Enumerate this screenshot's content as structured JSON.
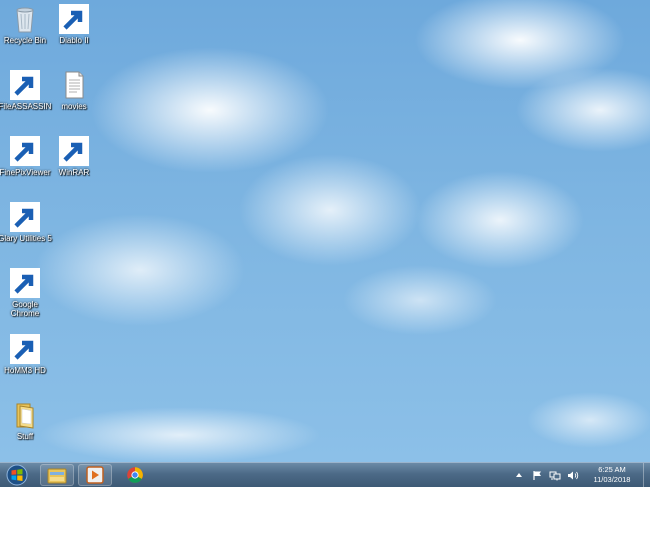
{
  "desktop": {
    "icons": [
      {
        "label": "Recycle Bin",
        "icon": "recycle-bin-icon"
      },
      {
        "label": "Diablo II",
        "icon": "diablo-icon"
      },
      {
        "label": "FileASSASSIN",
        "icon": "fileassassin-icon"
      },
      {
        "label": "movies",
        "icon": "text-file-icon"
      },
      {
        "label": "FinePixViewer",
        "icon": "finepix-icon"
      },
      {
        "label": "WinRAR",
        "icon": "winrar-icon"
      },
      {
        "label": "Glary Utilities 5",
        "icon": "glary-icon"
      },
      {
        "label": "Google Chrome",
        "icon": "chrome-icon"
      },
      {
        "label": "HoMM3 HD",
        "icon": "homm3-icon"
      },
      {
        "label": "Stuff",
        "icon": "folder-icon"
      }
    ]
  },
  "taskbar": {
    "start": "windows-start-icon",
    "pinned": [
      {
        "name": "Windows Explorer",
        "icon": "explorer-icon"
      },
      {
        "name": "Media Player",
        "icon": "media-player-icon"
      },
      {
        "name": "Google Chrome",
        "icon": "chrome-icon"
      }
    ],
    "tray": {
      "time": "6:25 AM",
      "date": "11/03/2018"
    }
  },
  "colors": {
    "sky": "#7fb6e2",
    "taskbar": "#4c6a87"
  }
}
